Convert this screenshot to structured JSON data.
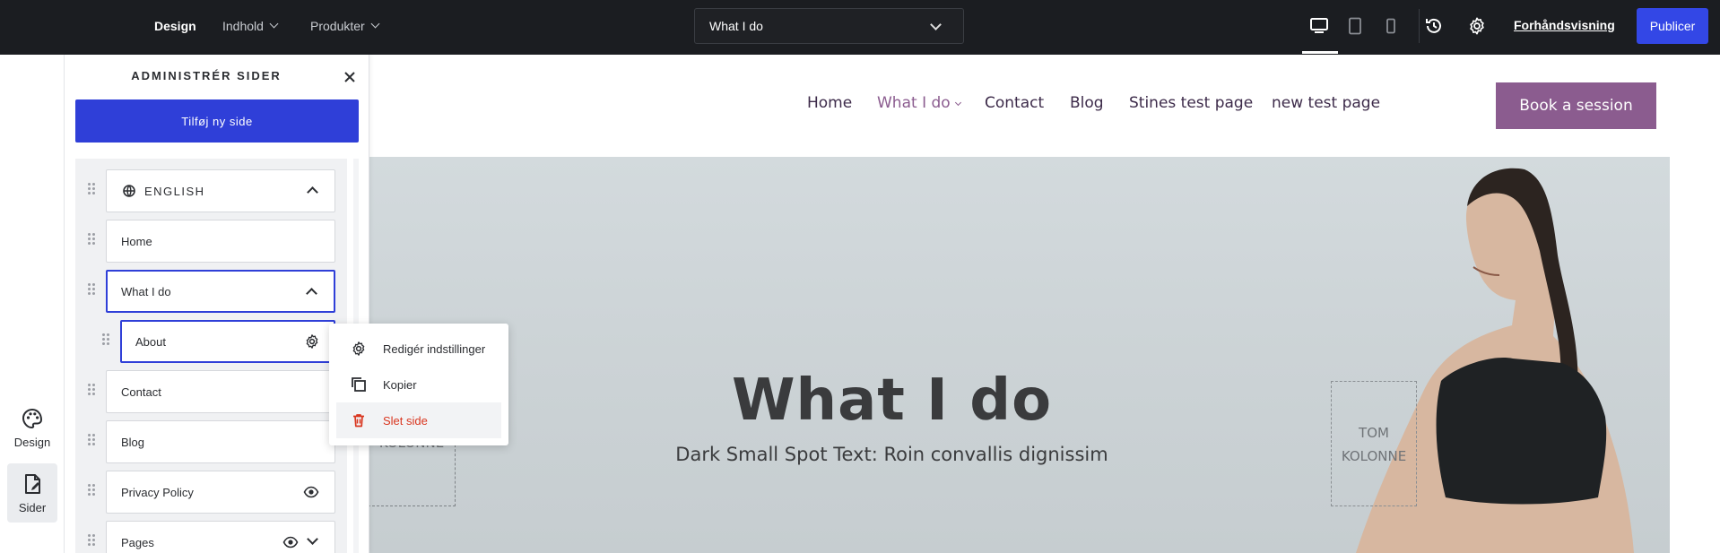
{
  "topbar": {
    "nav": [
      {
        "label": "Design"
      },
      {
        "label": "Indhold"
      },
      {
        "label": "Produkter"
      }
    ],
    "page_select": {
      "value": "What I do"
    },
    "devices": [
      "desktop-icon",
      "tablet-icon",
      "mobile-icon"
    ],
    "preview_label": "Forhåndsvisning",
    "publish_label": "Publicer"
  },
  "rail": {
    "items": [
      {
        "label": "Design",
        "icon": "palette-icon"
      },
      {
        "label": "Sider",
        "icon": "pages-icon"
      }
    ]
  },
  "panel": {
    "title": "ADMINISTRÉR SIDER",
    "add_button": "Tilføj ny side",
    "language": "ENGLISH",
    "pages": {
      "home": "Home",
      "what_i_do": "What I do",
      "about": "About",
      "contact": "Contact",
      "blog": "Blog",
      "privacy": "Privacy Policy",
      "pages": "Pages"
    }
  },
  "context_menu": {
    "items": [
      {
        "label": "Redigér indstillinger",
        "icon": "gear-icon"
      },
      {
        "label": "Kopier",
        "icon": "copy-icon"
      },
      {
        "label": "Slet side",
        "icon": "trash-icon"
      }
    ]
  },
  "site": {
    "nav": [
      "Home",
      "What I do",
      "Contact",
      "Blog",
      "Stines test page",
      "new test page"
    ],
    "book_button": "Book a session",
    "hero_title": "What I do",
    "hero_subtitle": "Dark Small Spot Text: Roin convallis dignissim",
    "empty_col_left": "KOLONNE",
    "empty_col_right_1": "TOM",
    "empty_col_right_2": "KOLONNE"
  },
  "colors": {
    "topbar": "#1b1d21",
    "accent": "#2f3fd8",
    "brand": "#8b5c8f",
    "danger": "#d9361f"
  }
}
